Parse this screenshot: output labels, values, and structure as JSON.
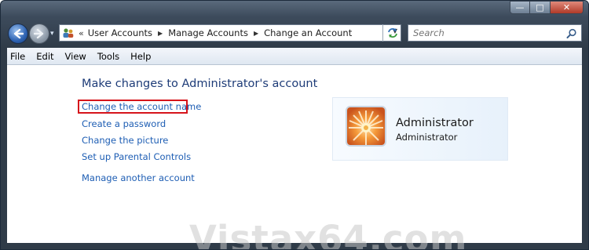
{
  "window": {
    "caption_buttons": {
      "minimize": "—",
      "maximize": "□",
      "close": "✕"
    }
  },
  "navigation": {
    "back_icon": "back-arrow-icon",
    "forward_icon": "forward-arrow-icon",
    "history_dropdown": "▾"
  },
  "address_bar": {
    "overflow_chevron": "«",
    "crumbs": [
      "User Accounts",
      "Manage Accounts",
      "Change an Account"
    ],
    "separator": "▶",
    "dropdown": "▼",
    "refresh_icon": "refresh-icon"
  },
  "search": {
    "placeholder": "Search"
  },
  "menu": {
    "items": [
      "File",
      "Edit",
      "View",
      "Tools",
      "Help"
    ]
  },
  "main": {
    "heading": "Make changes to Administrator's account",
    "tasks": [
      "Change the account name",
      "Create a password",
      "Change the picture",
      "Set up Parental Controls"
    ],
    "other_task": "Manage another account",
    "highlight_color": "#d6141b"
  },
  "account": {
    "name": "Administrator",
    "type": "Administrator",
    "picture_icon": "flower-picture"
  },
  "watermark": "Vistax64.com",
  "colors": {
    "link": "#1e5eb4",
    "heading": "#1e3c78",
    "frame": "#2f3b48"
  }
}
